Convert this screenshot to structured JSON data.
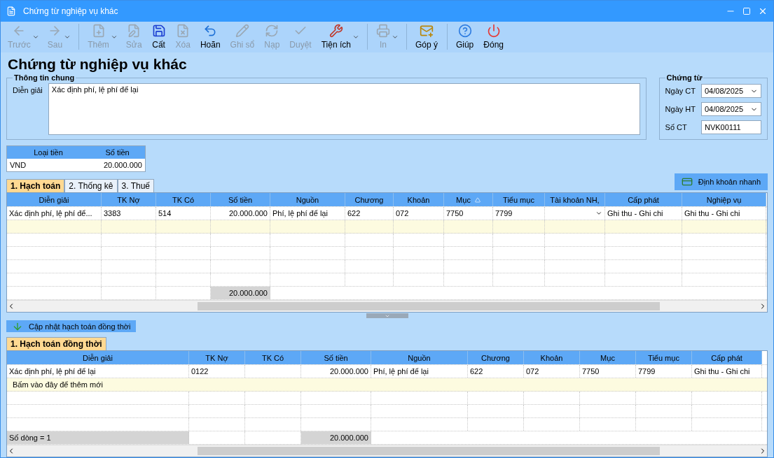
{
  "window": {
    "title": "Chứng từ nghiệp vụ khác"
  },
  "toolbar": [
    {
      "label": "Trước",
      "enabled": false,
      "dropdown": true,
      "separator_before": false
    },
    {
      "label": "Sau",
      "enabled": false,
      "dropdown": true,
      "separator_before": false
    },
    {
      "label": "Thêm",
      "enabled": false,
      "dropdown": true,
      "separator_before": true
    },
    {
      "label": "Sửa",
      "enabled": false,
      "dropdown": false,
      "separator_before": false
    },
    {
      "label": "Cất",
      "enabled": true,
      "dropdown": false,
      "separator_before": false
    },
    {
      "label": "Xóa",
      "enabled": false,
      "dropdown": false,
      "separator_before": false
    },
    {
      "label": "Hoãn",
      "enabled": true,
      "dropdown": false,
      "separator_before": false
    },
    {
      "label": "Ghi sổ",
      "enabled": false,
      "dropdown": false,
      "separator_before": false
    },
    {
      "label": "Nạp",
      "enabled": false,
      "dropdown": false,
      "separator_before": false
    },
    {
      "label": "Duyệt",
      "enabled": false,
      "dropdown": false,
      "separator_before": false
    },
    {
      "label": "Tiện ích",
      "enabled": true,
      "dropdown": true,
      "separator_before": false
    },
    {
      "label": "In",
      "enabled": false,
      "dropdown": true,
      "separator_before": true
    },
    {
      "label": "Góp ý",
      "enabled": true,
      "dropdown": false,
      "separator_before": true
    },
    {
      "label": "Giúp",
      "enabled": true,
      "dropdown": false,
      "separator_before": true
    },
    {
      "label": "Đóng",
      "enabled": true,
      "dropdown": false,
      "separator_before": false
    }
  ],
  "heading": "Chứng từ nghiệp vụ khác",
  "general": {
    "title": "Thông tin chung",
    "label": "Diễn giải",
    "value": "Xác định phí, lệ phí để lại"
  },
  "voucher": {
    "title": "Chứng từ",
    "fields": [
      {
        "label": "Ngày CT",
        "value": "04/08/2025",
        "kind": "date"
      },
      {
        "label": "Ngày HT",
        "value": "04/08/2025",
        "kind": "date"
      },
      {
        "label": "Số CT",
        "value": "NVK00111",
        "kind": "text"
      }
    ]
  },
  "currency": {
    "columns": [
      "Loại tiền",
      "Số tiền"
    ],
    "row": [
      "VND",
      "20.000.000"
    ]
  },
  "tabs": [
    {
      "label": "1. Hạch toán",
      "selected": true
    },
    {
      "label": "2. Thống kê",
      "selected": false
    },
    {
      "label": "3. Thuế",
      "selected": false
    }
  ],
  "quick_button": "Định khoản nhanh",
  "grid": {
    "columns": [
      {
        "label": "Diễn giải"
      },
      {
        "label": "TK Nợ"
      },
      {
        "label": "TK Có"
      },
      {
        "label": "Số tiền"
      },
      {
        "label": "Nguồn"
      },
      {
        "label": "Chương"
      },
      {
        "label": "Khoản"
      },
      {
        "label": "Mục",
        "sorted": true
      },
      {
        "label": "Tiểu mục"
      },
      {
        "label": "Tài khoản NH,",
        "dropdown": true
      },
      {
        "label": "Cấp phát"
      },
      {
        "label": "Nghiệp vụ"
      }
    ],
    "rows": [
      {
        "kind": "data",
        "cells": [
          "Xác định phí, lệ phí để...",
          "3383",
          "514",
          "20.000.000",
          "Phí, lệ phí để lại",
          "622",
          "072",
          "7750",
          "7799",
          "",
          "Ghi thu - Ghi chi",
          "Ghi thu - Ghi chi"
        ]
      },
      {
        "kind": "new"
      },
      {
        "kind": "empty"
      },
      {
        "kind": "empty"
      },
      {
        "kind": "empty"
      },
      {
        "kind": "empty"
      }
    ],
    "footer": [
      {
        "shaded": false
      },
      {
        "shaded": false
      },
      {
        "shaded": false
      },
      {
        "shaded": true,
        "text": "20.000.000"
      }
    ]
  },
  "update_button": "Cập nhật hạch toán đồng thời",
  "sub_tabs": [
    {
      "label": "1. Hạch toán đồng thời",
      "selected": true
    }
  ],
  "sub_grid": {
    "columns": [
      {
        "label": "Diễn giải"
      },
      {
        "label": "TK Nợ"
      },
      {
        "label": "TK Có"
      },
      {
        "label": "Số tiền"
      },
      {
        "label": "Nguồn"
      },
      {
        "label": "Chương"
      },
      {
        "label": "Khoản"
      },
      {
        "label": "Mục"
      },
      {
        "label": "Tiểu mục"
      },
      {
        "label": "Cấp phát"
      }
    ],
    "rows": [
      {
        "kind": "data",
        "cells": [
          "Xác định phí, lệ phí để lại",
          "0122",
          "",
          "20.000.000",
          "Phí, lệ phí để lại",
          "622",
          "072",
          "7750",
          "7799",
          "Ghi thu - Ghi chi"
        ]
      },
      {
        "kind": "new",
        "text": "Bấm vào đây để thêm mới"
      },
      {
        "kind": "empty"
      },
      {
        "kind": "empty"
      },
      {
        "kind": "empty"
      }
    ],
    "footer": [
      {
        "shaded": true,
        "text": "Số dòng = 1"
      },
      {
        "shaded": false
      },
      {
        "shaded": false
      },
      {
        "shaded": true,
        "text": "20.000.000"
      }
    ]
  }
}
